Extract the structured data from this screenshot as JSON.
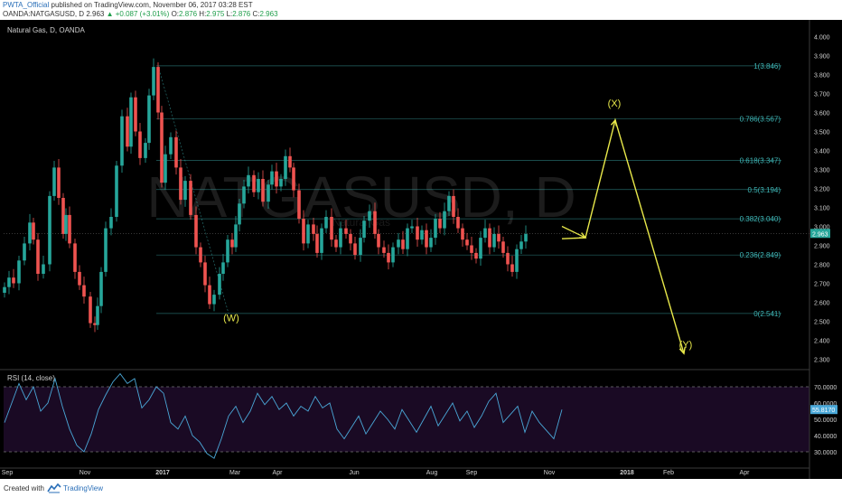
{
  "header": {
    "author": "PWTA_Official",
    "published": "published on TradingView.com, November 06, 2017 03:28 EST",
    "symbol": "OANDA:NATGASUSD, D",
    "last": "2.963",
    "change": "▲ +0.087 (+3.01%)",
    "o_label": "O:",
    "o_value": "2.876",
    "h_label": "H:",
    "h_value": "2.975",
    "l_label": "L:",
    "l_value": "2.876",
    "c_label": "C:",
    "c_value": "2.963"
  },
  "chart_data": {
    "type": "line",
    "title": "Natural Gas, D, OANDA",
    "watermark": "NATGASUSD, D",
    "watermark_sub": "Natural Gas",
    "price_axis": {
      "ylim": [
        2.25,
        4.05
      ],
      "ticks": [
        "4.000",
        "3.900",
        "3.800",
        "3.700",
        "3.600",
        "3.500",
        "3.400",
        "3.300",
        "3.200",
        "3.100",
        "3.000",
        "2.900",
        "2.800",
        "2.700",
        "2.600",
        "2.500",
        "2.400",
        "2.300"
      ]
    },
    "last_price_label": "2.963",
    "time_axis": {
      "labels": [
        "Sep",
        "Nov",
        "2017",
        "Mar",
        "Apr",
        "Jun",
        "Aug",
        "Sep",
        "Nov",
        "2018",
        "Feb",
        "Apr"
      ],
      "bold": [
        "2017",
        "2018"
      ]
    },
    "price_series": {
      "name": "NATGASUSD",
      "x": [
        0,
        5,
        10,
        16,
        22,
        28,
        32,
        37,
        43,
        50,
        55,
        60,
        65,
        68,
        72,
        78,
        83,
        88,
        95,
        100,
        103,
        107,
        112,
        118,
        124,
        130,
        136,
        140,
        145,
        150,
        156,
        160,
        165,
        170,
        174,
        178,
        184,
        190,
        195,
        200,
        206,
        212,
        217,
        222,
        227,
        232,
        238,
        242,
        247,
        252,
        256,
        260,
        265,
        270,
        276,
        281,
        286,
        292,
        296,
        301,
        306,
        311,
        316,
        320,
        326,
        331,
        336,
        342,
        346,
        351,
        356,
        362,
        367,
        372,
        378,
        383,
        388,
        394,
        398,
        404,
        410,
        414,
        420,
        425,
        430,
        436,
        441,
        446,
        451,
        457,
        462,
        467,
        472,
        477,
        482,
        487,
        492,
        497,
        502,
        507,
        512,
        517,
        522,
        527,
        532,
        537,
        542,
        547,
        552,
        557,
        562,
        567,
        572,
        577,
        582,
        587,
        592,
        597,
        602,
        607,
        612,
        617
      ],
      "close": [
        2.68,
        2.73,
        2.7,
        2.82,
        2.91,
        3.02,
        2.93,
        2.75,
        2.8,
        3.16,
        3.31,
        3.15,
        2.96,
        3.06,
        2.91,
        2.76,
        2.69,
        2.63,
        2.49,
        2.48,
        2.58,
        2.76,
        2.99,
        3.05,
        3.32,
        3.58,
        3.42,
        3.68,
        3.5,
        3.36,
        3.44,
        3.69,
        3.84,
        3.6,
        3.23,
        3.38,
        3.47,
        3.31,
        3.14,
        3.24,
        3.06,
        2.89,
        2.81,
        2.69,
        2.59,
        2.64,
        2.75,
        2.81,
        2.93,
        2.89,
        3.01,
        3.12,
        3.21,
        3.27,
        3.18,
        3.25,
        3.13,
        3.22,
        3.29,
        3.21,
        3.25,
        3.37,
        3.31,
        3.19,
        3.04,
        2.91,
        3.01,
        2.96,
        2.86,
        2.99,
        3.05,
        2.93,
        2.89,
        2.99,
        2.96,
        2.91,
        2.85,
        2.94,
        3.03,
        3.08,
        2.96,
        2.89,
        2.86,
        2.81,
        2.89,
        2.93,
        2.88,
        2.99,
        3.0,
        2.93,
        2.98,
        2.89,
        2.94,
        3.04,
        2.99,
        3.08,
        3.16,
        3.05,
        2.99,
        2.93,
        2.9,
        2.86,
        2.83,
        2.94,
        2.99,
        2.89,
        2.96,
        2.92,
        2.86,
        2.8,
        2.76,
        2.88,
        2.92,
        2.96
      ],
      "color_up": "#26a69a",
      "color_down": "#ef5350"
    },
    "fib_levels": [
      {
        "label": "1(3.846)",
        "value": 3.846
      },
      {
        "label": "0.786(3.567)",
        "value": 3.567
      },
      {
        "label": "0.618(3.347)",
        "value": 3.347
      },
      {
        "label": "0.5(3.194)",
        "value": 3.194
      },
      {
        "label": "0.382(3.040)",
        "value": 3.04
      },
      {
        "label": "0.236(2.849)",
        "value": 2.849
      },
      {
        "label": "0(2.541)",
        "value": 2.541
      }
    ],
    "fib_color": "#3fb8b8",
    "fib_x_start": 173,
    "projection": {
      "color": "#e8e84a",
      "path": [
        {
          "x": 617,
          "y": 2.935
        },
        {
          "x": 643,
          "y": 2.94
        },
        {
          "x": 676,
          "y": 3.56
        },
        {
          "x": 752,
          "y": 2.33
        }
      ],
      "lead_arrow": [
        {
          "x": 617,
          "y": 3.0
        },
        {
          "x": 643,
          "y": 2.94
        }
      ]
    },
    "wave_labels": [
      {
        "text": "(W)",
        "x": 251,
        "y": 2.5
      },
      {
        "text": "(X)",
        "x": 675,
        "y": 3.63
      },
      {
        "text": "(Y)",
        "x": 754,
        "y": 2.36
      }
    ],
    "rsi": {
      "label": "RSI (14, close)",
      "ylim": [
        20,
        80
      ],
      "ticks": [
        "70.0000",
        "60.0000",
        "50.0000",
        "40.0000",
        "30.0000"
      ],
      "value_label": "55.8170",
      "overbought": 70,
      "oversold": 30,
      "color": "#4aa8d8",
      "x": [
        0,
        8,
        16,
        24,
        32,
        40,
        48,
        56,
        64,
        72,
        80,
        88,
        96,
        104,
        112,
        120,
        128,
        136,
        144,
        152,
        160,
        168,
        176,
        184,
        192,
        200,
        208,
        216,
        224,
        232,
        240,
        248,
        256,
        264,
        272,
        280,
        288,
        296,
        304,
        312,
        320,
        328,
        336,
        344,
        352,
        360,
        368,
        376,
        384,
        392,
        400,
        408,
        416,
        424,
        432,
        440,
        448,
        456,
        464,
        472,
        480,
        488,
        496,
        504,
        512,
        520,
        528,
        536,
        544,
        552,
        560,
        568,
        576,
        584,
        592,
        600,
        608,
        617
      ],
      "values": [
        48,
        60,
        72,
        62,
        70,
        55,
        60,
        75,
        58,
        44,
        34,
        30,
        41,
        56,
        65,
        73,
        78,
        72,
        75,
        57,
        62,
        70,
        66,
        48,
        44,
        52,
        40,
        36,
        29,
        26,
        38,
        52,
        58,
        48,
        55,
        66,
        59,
        64,
        56,
        60,
        52,
        58,
        55,
        64,
        57,
        60,
        44,
        38,
        45,
        52,
        41,
        48,
        55,
        50,
        44,
        56,
        49,
        42,
        50,
        58,
        46,
        53,
        60,
        49,
        55,
        45,
        52,
        61,
        66,
        48,
        53,
        58,
        42,
        55,
        48,
        43,
        38,
        56
      ]
    }
  },
  "footer": {
    "created_with": "Created with",
    "brand": "TradingView"
  }
}
